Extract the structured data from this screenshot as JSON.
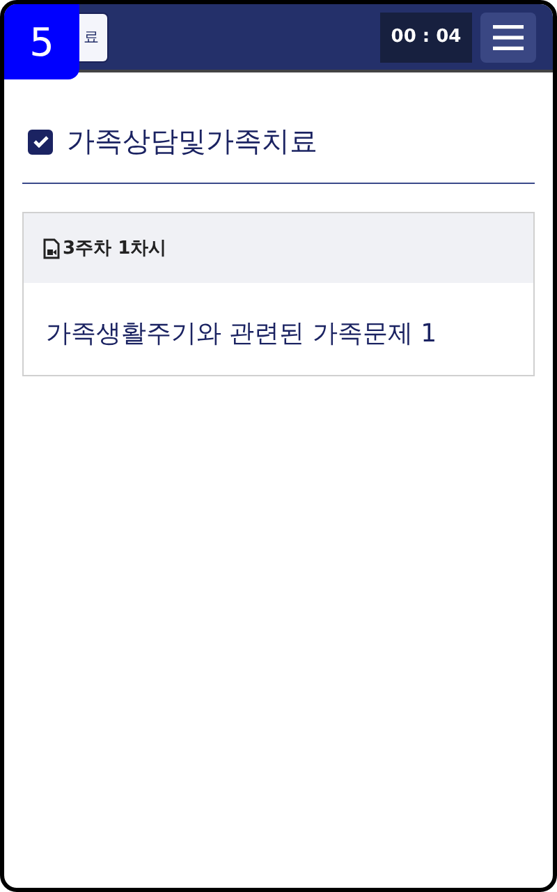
{
  "badge": "5",
  "header": {
    "exit_button": "료",
    "timer": "00 : 04"
  },
  "course": {
    "title": "가족상담및가족치료",
    "checked": true
  },
  "lesson": {
    "week": "3주차 1차시",
    "title": "가족생활주기와 관련된 가족문제 1"
  }
}
